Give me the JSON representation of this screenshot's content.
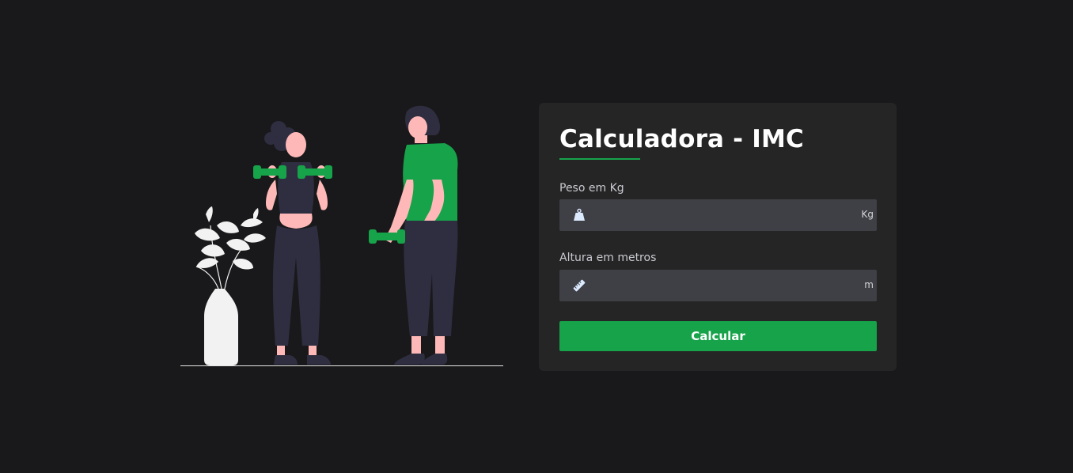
{
  "colors": {
    "background": "#19191b",
    "card": "#252526",
    "input": "#3f3f46",
    "accent": "#16a34a",
    "text": "#ffffff",
    "muted": "#c9c9d0"
  },
  "illustration": {
    "description_icon": "fitness-people-illustration"
  },
  "form": {
    "title": "Calculadora - IMC",
    "weight": {
      "label": "Peso em Kg",
      "icon": "weight-icon",
      "value": "",
      "unit": "Kg"
    },
    "height": {
      "label": "Altura em metros",
      "icon": "ruler-icon",
      "value": "",
      "unit": "m"
    },
    "submit_label": "Calcular"
  }
}
